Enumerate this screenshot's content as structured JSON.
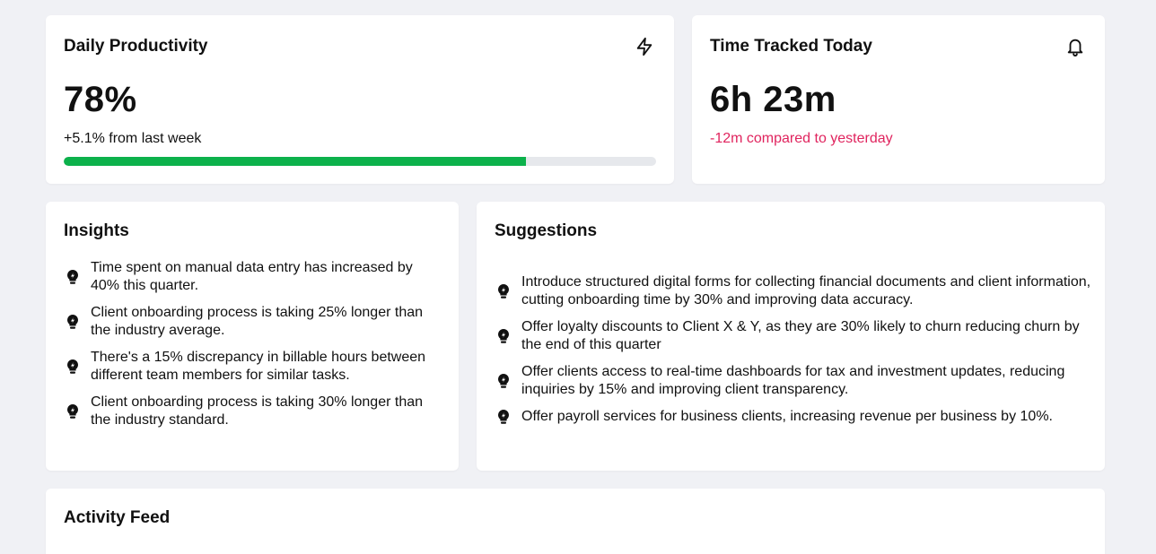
{
  "productivity": {
    "title": "Daily Productivity",
    "icon": "lightning-icon",
    "value": "78%",
    "change": "+5.1% from last week",
    "progress_percent": 78,
    "progress_color": "#0cb14b"
  },
  "time_tracked": {
    "title": "Time Tracked Today",
    "icon": "bell-icon",
    "value": "6h 23m",
    "change": "-12m compared to yesterday",
    "change_color": "#e0245e"
  },
  "insights": {
    "title": "Insights",
    "icon": "lightbulb-icon",
    "items": [
      "Time spent on manual data entry has increased by 40% this quarter.",
      "Client onboarding process is taking 25% longer than the industry average.",
      "There's a 15% discrepancy in billable hours between different team members for similar tasks.",
      "Client onboarding process is taking 30% longer than the industry standard."
    ]
  },
  "suggestions": {
    "title": "Suggestions",
    "icon": "lightbulb-icon",
    "items": [
      "Introduce structured digital forms for collecting financial documents and client information, cutting onboarding time by 30% and improving data accuracy.",
      "Offer loyalty discounts to Client X & Y, as they are 30% likely to churn reducing churn by the end of this quarter",
      "Offer clients access to real-time dashboards for tax and investment updates, reducing inquiries by 15% and improving client transparency.",
      "Offer payroll services for business clients, increasing revenue per business by 10%."
    ]
  },
  "activity_feed": {
    "title": "Activity Feed"
  }
}
